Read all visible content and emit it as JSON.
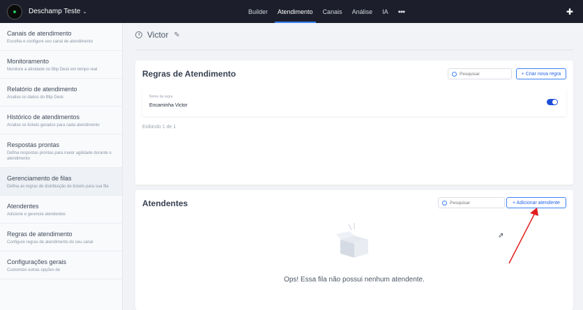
{
  "topbar": {
    "brand_name": "Deschamp Teste",
    "brand_chevron": "⌄",
    "nav": [
      "Builder",
      "Atendimento",
      "Canais",
      "Análise",
      "IA"
    ],
    "nav_more": "•••",
    "puzzle_glyph": "✚"
  },
  "sidebar": {
    "items": [
      {
        "title": "Canais de atendimento",
        "desc": "Escolha e configure seu canal de atendimento"
      },
      {
        "title": "Monitoramento",
        "desc": "Monitore a atividade no Blip Desk em tempo real"
      },
      {
        "title": "Relatório de atendimento",
        "desc": "Analise os dados do Blip Desk"
      },
      {
        "title": "Histórico de atendimentos",
        "desc": "Analise os tickets gerados para cada atendimento"
      },
      {
        "title": "Respostas prontas",
        "desc": "Defina respostas prontas para maior agilidade durante o atendimento"
      },
      {
        "title": "Gerenciamento de filas",
        "desc": "Defina as regras de distribuição de tickets para sua fila"
      },
      {
        "title": "Atendentes",
        "desc": "Adicione e gerencie atendentes"
      },
      {
        "title": "Regras de atendimento",
        "desc": "Configure regras de atendimento do seu canal"
      },
      {
        "title": "Configurações gerais",
        "desc": "Customize outras opções de"
      }
    ]
  },
  "queue": {
    "name": "Victor",
    "pencil": "✎"
  },
  "rules": {
    "title": "Regras de Atendimento",
    "search_placeholder": "Pesquisar",
    "create_button": "+ Criar nova regra",
    "row_label": "Nome da regra",
    "row_value": "Encaminha Victor",
    "toggle_on": true,
    "showing": "Exibindo 1 de 1"
  },
  "agents": {
    "title": "Atendentes",
    "search_placeholder": "Pesquisar",
    "add_button": "+ Adicionar atendente",
    "empty_text": "Ops! Essa fila não possui nenhum atendente."
  },
  "colors": {
    "topbar": "#1c1f2b",
    "accent": "#3b82f6",
    "annotation_arrow": "#e11d1d"
  },
  "icons": {
    "cursor": "⇗"
  }
}
